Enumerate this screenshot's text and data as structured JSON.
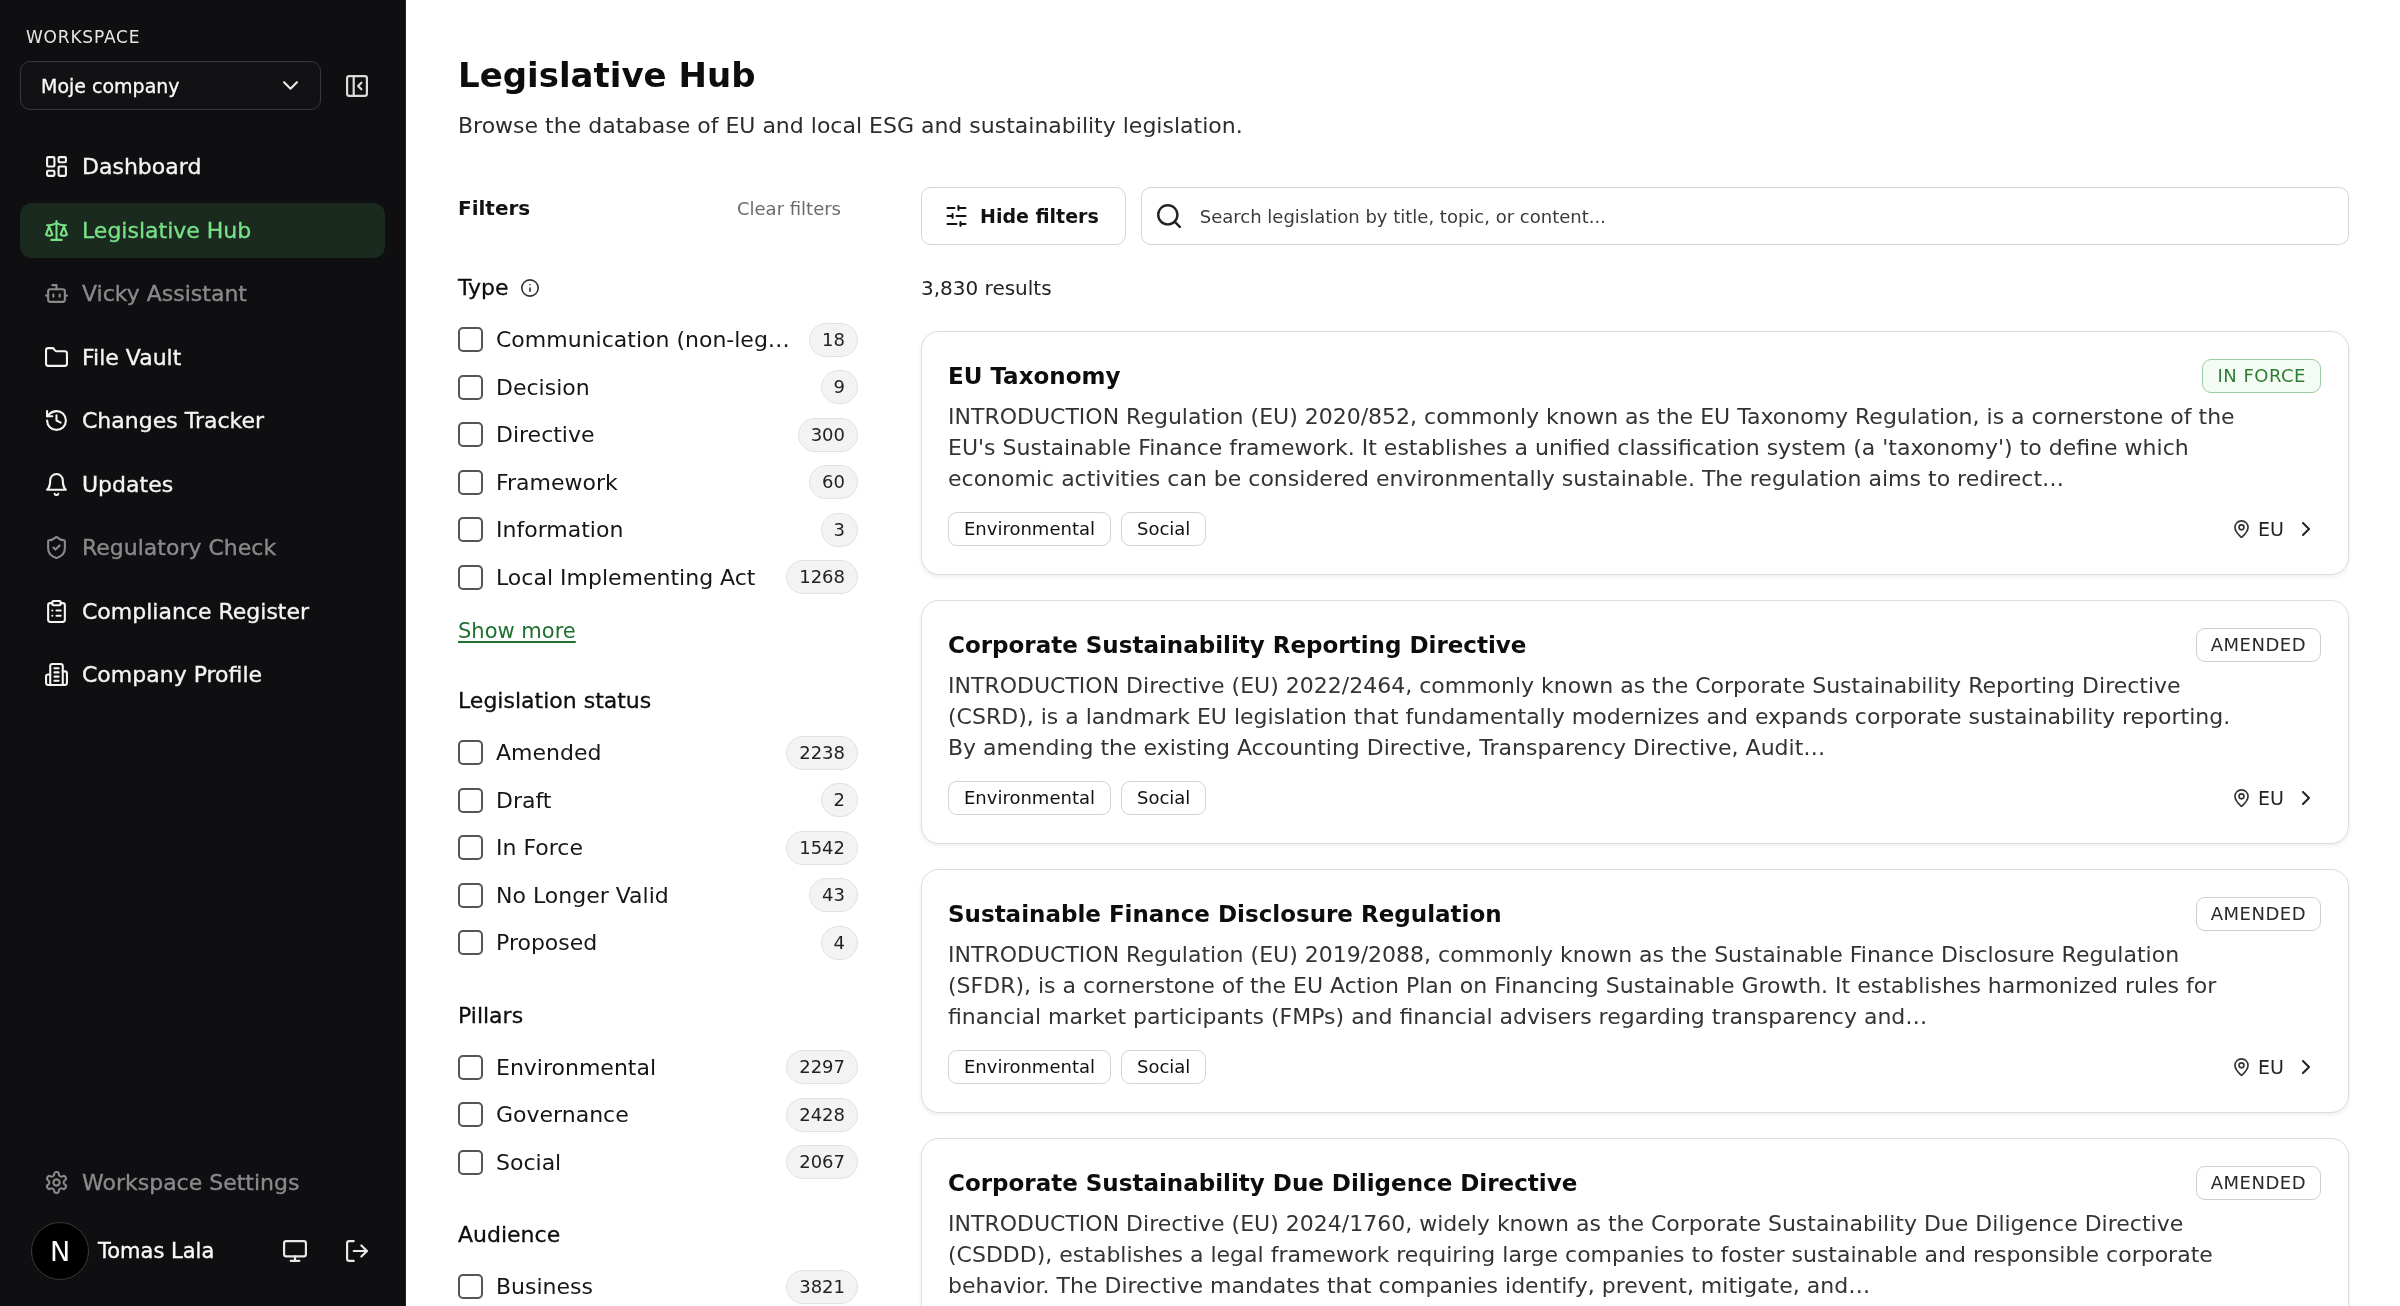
{
  "sidebar": {
    "workspace_label": "WORKSPACE",
    "workspace": "Moje company",
    "nav": [
      {
        "label": "Dashboard",
        "selected": false,
        "disabled": false
      },
      {
        "label": "Legislative Hub",
        "selected": true,
        "disabled": false
      },
      {
        "label": "Vicky Assistant",
        "selected": false,
        "disabled": true
      },
      {
        "label": "File Vault",
        "selected": false,
        "disabled": false
      },
      {
        "label": "Changes Tracker",
        "selected": false,
        "disabled": false
      },
      {
        "label": "Updates",
        "selected": false,
        "disabled": false
      },
      {
        "label": "Regulatory Check",
        "selected": false,
        "disabled": true
      },
      {
        "label": "Compliance Register",
        "selected": false,
        "disabled": false
      },
      {
        "label": "Company Profile",
        "selected": false,
        "disabled": false
      }
    ],
    "settings": {
      "label": "Workspace Settings",
      "disabled": true
    },
    "user": {
      "initial": "N",
      "name": "Tomas Lala"
    }
  },
  "header": {
    "title": "Legislative Hub",
    "subtitle": "Browse the database of EU and local ESG and sustainability legislation."
  },
  "filters": {
    "title": "Filters",
    "clear": "Clear filters",
    "sections": [
      {
        "title": "Type",
        "info": true,
        "options": [
          {
            "label": "Communication (non-leg…",
            "count": "18",
            "checked": false
          },
          {
            "label": "Decision",
            "count": "9",
            "checked": false
          },
          {
            "label": "Directive",
            "count": "300",
            "checked": false
          },
          {
            "label": "Framework",
            "count": "60",
            "checked": false
          },
          {
            "label": "Information",
            "count": "3",
            "checked": false
          },
          {
            "label": "Local Implementing Act",
            "count": "1268",
            "checked": false
          }
        ],
        "show_more": "Show more"
      },
      {
        "title": "Legislation status",
        "info": false,
        "options": [
          {
            "label": "Amended",
            "count": "2238",
            "checked": false
          },
          {
            "label": "Draft",
            "count": "2",
            "checked": false
          },
          {
            "label": "In Force",
            "count": "1542",
            "checked": false
          },
          {
            "label": "No Longer Valid",
            "count": "43",
            "checked": false
          },
          {
            "label": "Proposed",
            "count": "4",
            "checked": false
          }
        ]
      },
      {
        "title": "Pillars",
        "info": false,
        "options": [
          {
            "label": "Environmental",
            "count": "2297",
            "checked": false
          },
          {
            "label": "Governance",
            "count": "2428",
            "checked": false
          },
          {
            "label": "Social",
            "count": "2067",
            "checked": false
          }
        ]
      },
      {
        "title": "Audience",
        "info": false,
        "options": [
          {
            "label": "Business",
            "count": "3821",
            "checked": false
          }
        ]
      }
    ]
  },
  "results": {
    "hide_filters": "Hide filters",
    "search": {
      "placeholder": "Search legislation by title, topic, or content..."
    },
    "count": "3,830 results",
    "cards": [
      {
        "title": "EU Taxonomy",
        "status": {
          "label": "IN FORCE",
          "kind": "in-force"
        },
        "description": "INTRODUCTION Regulation (EU) 2020/852, commonly known as the EU Taxonomy Regulation, is a cornerstone of the EU's Sustainable Finance framework. It establishes a unified classification system (a 'taxonomy') to define which economic activities can be considered environmentally sustainable. The regulation aims to redirect…",
        "tags": [
          "Environmental",
          "Social"
        ],
        "region": "EU"
      },
      {
        "title": "Corporate Sustainability Reporting Directive",
        "status": {
          "label": "AMENDED",
          "kind": "amended"
        },
        "description": "INTRODUCTION Directive (EU) 2022/2464, commonly known as the Corporate Sustainability Reporting Directive (CSRD), is a landmark EU legislation that fundamentally modernizes and expands corporate sustainability reporting. By amending the existing Accounting Directive, Transparency Directive, Audit…",
        "tags": [
          "Environmental",
          "Social"
        ],
        "region": "EU"
      },
      {
        "title": "Sustainable Finance Disclosure Regulation",
        "status": {
          "label": "AMENDED",
          "kind": "amended"
        },
        "description": "INTRODUCTION Regulation (EU) 2019/2088, commonly known as the Sustainable Finance Disclosure Regulation (SFDR), is a cornerstone of the EU Action Plan on Financing Sustainable Growth. It establishes harmonized rules for financial market participants (FMPs) and financial advisers regarding transparency and…",
        "tags": [
          "Environmental",
          "Social"
        ],
        "region": "EU"
      },
      {
        "title": "Corporate Sustainability Due Diligence Directive",
        "status": {
          "label": "AMENDED",
          "kind": "amended"
        },
        "description": "INTRODUCTION Directive (EU) 2024/1760, widely known as the Corporate Sustainability Due Diligence Directive (CSDDD), establishes a legal framework requiring large companies to foster sustainable and responsible corporate behavior. The Directive mandates that companies identify, prevent, mitigate, and…"
      }
    ]
  }
}
